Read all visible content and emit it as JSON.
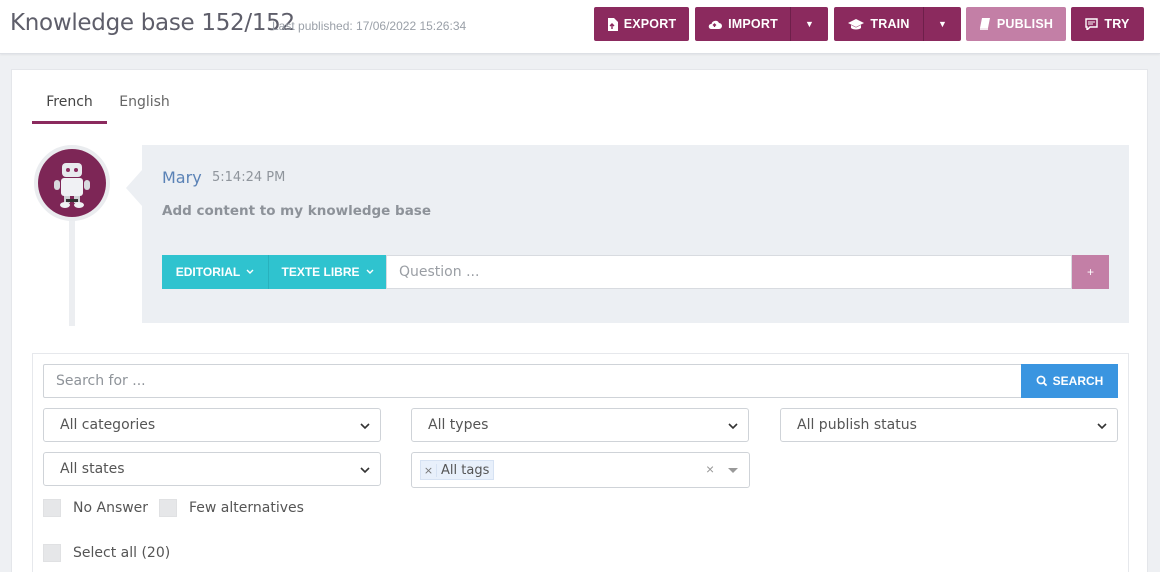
{
  "header": {
    "title": "Knowledge base 152/152",
    "subtitle": "Last published: 17/06/2022 15:26:34",
    "buttons": {
      "export": "EXPORT",
      "import": "IMPORT",
      "train": "TRAIN",
      "publish": "PUBLISH",
      "try": "TRY"
    }
  },
  "tabs": [
    "French",
    "English"
  ],
  "message": {
    "author": "Mary",
    "time": "5:14:24 PM",
    "text": "Add content to my knowledge base"
  },
  "question_bar": {
    "editorial_label": "EDITORIAL",
    "mode_label": "TEXTE LIBRE",
    "placeholder": "Question ...",
    "add_label": "+"
  },
  "filters": {
    "search_placeholder": "Search for ...",
    "search_label": "SEARCH",
    "categories": "All categories",
    "types": "All types",
    "publish_status": "All publish status",
    "states": "All states",
    "tags": "All tags",
    "no_answer": "No Answer",
    "few_alternatives": "Few alternatives",
    "select_all": "Select all (20)"
  },
  "colors": {
    "brand": "#8b2a5e",
    "brand_light": "#c37fa6",
    "teal": "#2fc3cf",
    "search_blue": "#3a95e0"
  }
}
